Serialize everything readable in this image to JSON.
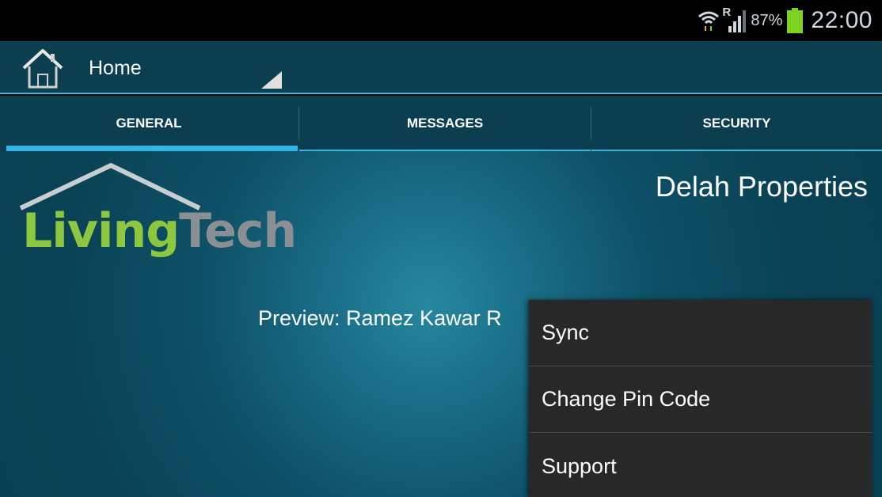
{
  "status_bar": {
    "roaming_indicator": "R",
    "battery_percent": "87%",
    "clock": "22:00",
    "icons": [
      "wifi-icon",
      "signal-icon",
      "battery-icon"
    ]
  },
  "action_bar": {
    "title": "Home",
    "icon": "home-icon"
  },
  "tabs": [
    {
      "label": "GENERAL",
      "selected": true
    },
    {
      "label": "MESSAGES",
      "selected": false
    },
    {
      "label": "SECURITY",
      "selected": false
    }
  ],
  "content": {
    "logo": {
      "part1": "Living",
      "part2": "Tech"
    },
    "company_name": "Delah Properties",
    "preview_text": "Preview: Ramez Kawar R"
  },
  "menu": {
    "items": [
      {
        "label": "Sync"
      },
      {
        "label": "Change Pin Code"
      },
      {
        "label": "Support"
      }
    ]
  },
  "colors": {
    "accent": "#33b5e5",
    "action_bar_bg": "#0b3f50",
    "logo_green": "#8dc63f",
    "logo_gray": "#8a8f93",
    "menu_bg": "#282828"
  }
}
